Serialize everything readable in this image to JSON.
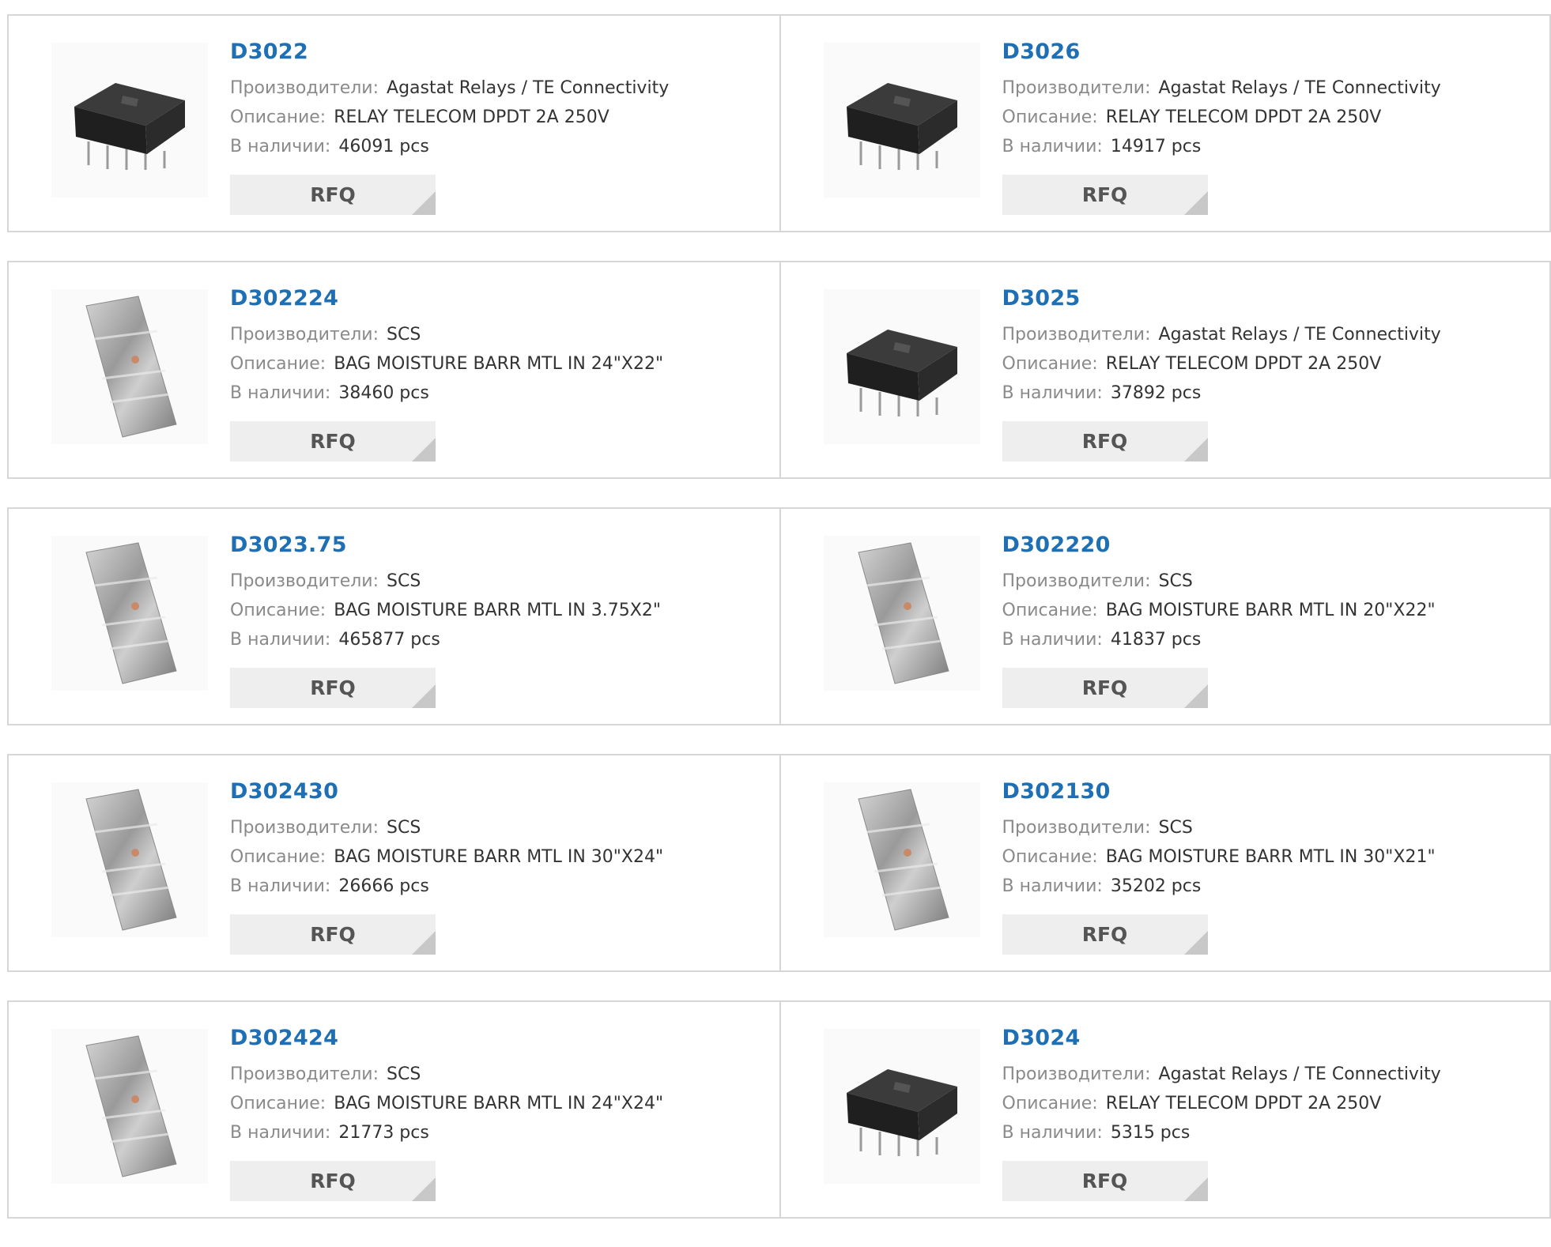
{
  "labels": {
    "manufacturer": "Производители:",
    "description": "Описание:",
    "stock": "В наличии:",
    "rfq": "RFQ"
  },
  "products": [
    {
      "pn": "D3022",
      "manufacturer": "Agastat Relays / TE Connectivity",
      "description": "RELAY TELECOM DPDT 2A 250V",
      "stock": "46091 pcs",
      "image": "relay-image"
    },
    {
      "pn": "D3026",
      "manufacturer": "Agastat Relays / TE Connectivity",
      "description": "RELAY TELECOM DPDT 2A 250V",
      "stock": "14917 pcs",
      "image": "relay-image"
    },
    {
      "pn": "D302224",
      "manufacturer": "SCS",
      "description": "BAG MOISTURE BARR MTL IN 24\"X22\"",
      "stock": "38460 pcs",
      "image": "bag-image"
    },
    {
      "pn": "D3025",
      "manufacturer": "Agastat Relays / TE Connectivity",
      "description": "RELAY TELECOM DPDT 2A 250V",
      "stock": "37892 pcs",
      "image": "relay-image"
    },
    {
      "pn": "D3023.75",
      "manufacturer": "SCS",
      "description": "BAG MOISTURE BARR MTL IN 3.75X2\"",
      "stock": "465877 pcs",
      "image": "bag-image"
    },
    {
      "pn": "D302220",
      "manufacturer": "SCS",
      "description": "BAG MOISTURE BARR MTL IN 20\"X22\"",
      "stock": "41837 pcs",
      "image": "bag-image"
    },
    {
      "pn": "D302430",
      "manufacturer": "SCS",
      "description": "BAG MOISTURE BARR MTL IN 30\"X24\"",
      "stock": "26666 pcs",
      "image": "bag-image"
    },
    {
      "pn": "D302130",
      "manufacturer": "SCS",
      "description": "BAG MOISTURE BARR MTL IN 30\"X21\"",
      "stock": "35202 pcs",
      "image": "bag-image"
    },
    {
      "pn": "D302424",
      "manufacturer": "SCS",
      "description": "BAG MOISTURE BARR MTL IN 24\"X24\"",
      "stock": "21773 pcs",
      "image": "bag-image"
    },
    {
      "pn": "D3024",
      "manufacturer": "Agastat Relays / TE Connectivity",
      "description": "RELAY TELECOM DPDT 2A 250V",
      "stock": "5315 pcs",
      "image": "relay-image"
    }
  ],
  "colors": {
    "link": "#1f6fb5",
    "label": "#8a8a8a",
    "border": "#d6d6d6",
    "button": "#eeeeee"
  }
}
